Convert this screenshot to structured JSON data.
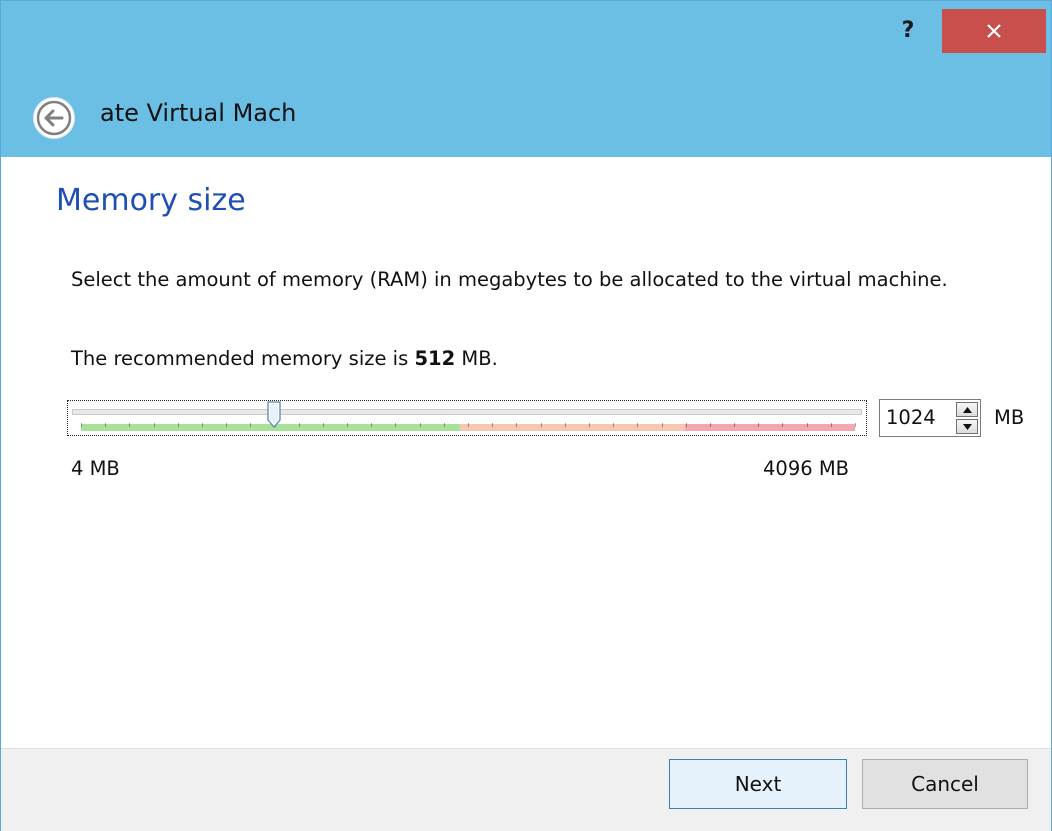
{
  "window": {
    "help_label": "?",
    "close_icon": "close-icon"
  },
  "header": {
    "title": "ate Virtual Mach",
    "back_icon": "arrow-left-icon"
  },
  "page": {
    "title": "Memory size",
    "description": "Select the amount of memory (RAM) in megabytes to be allocated to the virtual machine.",
    "recommend_prefix": "The recommended memory size is ",
    "recommend_value": "512",
    "recommend_suffix": " MB."
  },
  "memory": {
    "min_label": "4 MB",
    "max_label": "4096 MB",
    "min_value": 4,
    "max_value": 4096,
    "current_value": 1024,
    "spin_value": "1024",
    "unit": "MB",
    "range_colors": {
      "safe": "#a8e29a",
      "warning": "#f6c8b4",
      "danger": "#f2a8ae"
    }
  },
  "footer": {
    "next_label": "Next",
    "cancel_label": "Cancel"
  }
}
